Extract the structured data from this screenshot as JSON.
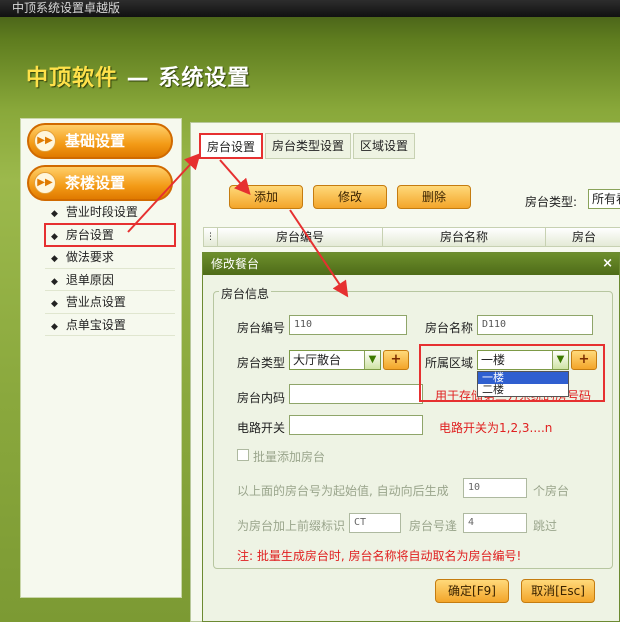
{
  "window": {
    "title": "中顶系统设置卓越版"
  },
  "header": {
    "brand": "中顶软件",
    "separator": " — ",
    "section": "系统设置"
  },
  "sidebar": {
    "categories": [
      {
        "label": "基础设置"
      },
      {
        "label": "茶楼设置"
      }
    ],
    "items": [
      {
        "label": "营业时段设置"
      },
      {
        "label": "房台设置"
      },
      {
        "label": "做法要求"
      },
      {
        "label": "退单原因"
      },
      {
        "label": "营业点设置"
      },
      {
        "label": "点单宝设置"
      }
    ],
    "selected_item": "房台设置"
  },
  "tabs": [
    {
      "label": "房台设置",
      "active": true
    },
    {
      "label": "房台类型设置",
      "active": false
    },
    {
      "label": "区域设置",
      "active": false
    }
  ],
  "toolbar": {
    "add_label": "添加",
    "edit_label": "修改",
    "delete_label": "删除",
    "filter_label": "房台类型:",
    "filter_value": "所有看"
  },
  "grid": {
    "columns": [
      "房台编号",
      "房台名称",
      "房台"
    ]
  },
  "dialog": {
    "title": "修改餐台",
    "close_symbol": "×",
    "group_title": "房台信息",
    "room_no_label": "房台编号",
    "room_no_value": "110",
    "room_name_label": "房台名称",
    "room_name_value": "D110",
    "room_type_label": "房台类型",
    "room_type_value": "大厅散台",
    "area_label": "所属区域",
    "area_value": "一楼",
    "area_options": [
      "一楼",
      "二楼"
    ],
    "plus_symbol": "+",
    "inner_code_label": "房台内码",
    "inner_code_value": "",
    "inner_code_hint": "用于存储第三方系统的房号码",
    "power_label": "电路开关",
    "power_value": "",
    "power_hint": "电路开关为1,2,3....n",
    "batch_label": "批量添加房台",
    "batch_count_prefix": "以上面的房台号为起始值, 自动向后生成",
    "batch_count_value": "10",
    "batch_count_suffix": "个房台",
    "prefix_label": "为房台加上前缀标识",
    "prefix_value": "CT",
    "skip_label": "房台号逢",
    "skip_value": "4",
    "skip_suffix": "跳过",
    "note": "注: 批量生成房台时, 房台名称将自动取名为房台编号!",
    "ok_label": "确定[F9]",
    "cancel_label": "取消[Esc]"
  },
  "colors": {
    "accent_orange": "#f3a52a",
    "highlight_red": "#e63030",
    "dialog_title_green": "#5a7a20"
  }
}
